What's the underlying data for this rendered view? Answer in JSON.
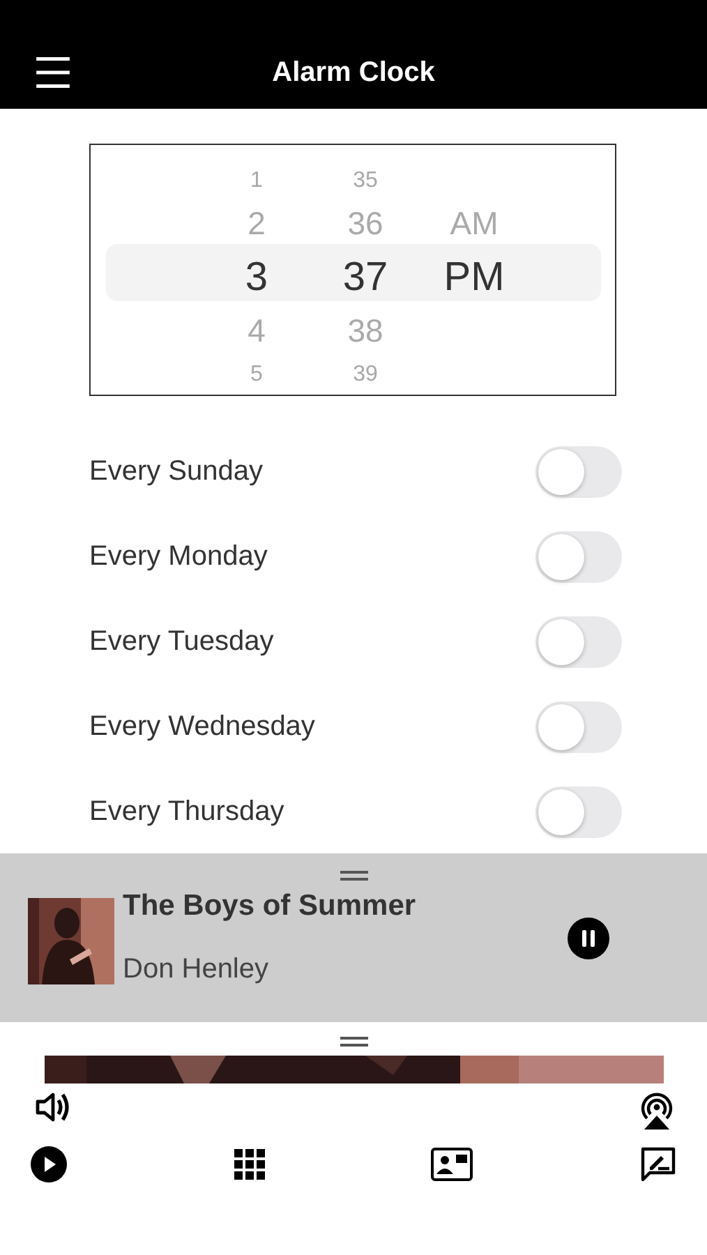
{
  "header": {
    "title": "Alarm Clock"
  },
  "picker": {
    "columns": [
      {
        "items": [
          {
            "label": "1",
            "selected": false
          },
          {
            "label": "2",
            "selected": false
          },
          {
            "label": "3",
            "selected": true
          },
          {
            "label": "4",
            "selected": false
          },
          {
            "label": "5",
            "selected": false
          }
        ]
      },
      {
        "items": [
          {
            "label": "35",
            "selected": false
          },
          {
            "label": "36",
            "selected": false
          },
          {
            "label": "37",
            "selected": true
          },
          {
            "label": "38",
            "selected": false
          },
          {
            "label": "39",
            "selected": false
          }
        ]
      },
      {
        "items": [
          {
            "label": "AM",
            "selected": false
          },
          {
            "label": "PM",
            "selected": true
          }
        ]
      }
    ]
  },
  "repeat": [
    {
      "label": "Every Sunday",
      "on": false
    },
    {
      "label": "Every Monday",
      "on": false
    },
    {
      "label": "Every Tuesday",
      "on": false
    },
    {
      "label": "Every Wednesday",
      "on": false
    },
    {
      "label": "Every Thursday",
      "on": false
    }
  ],
  "now_playing": {
    "title": "The Boys of Summer",
    "artist": "Don Henley",
    "playing": true
  }
}
